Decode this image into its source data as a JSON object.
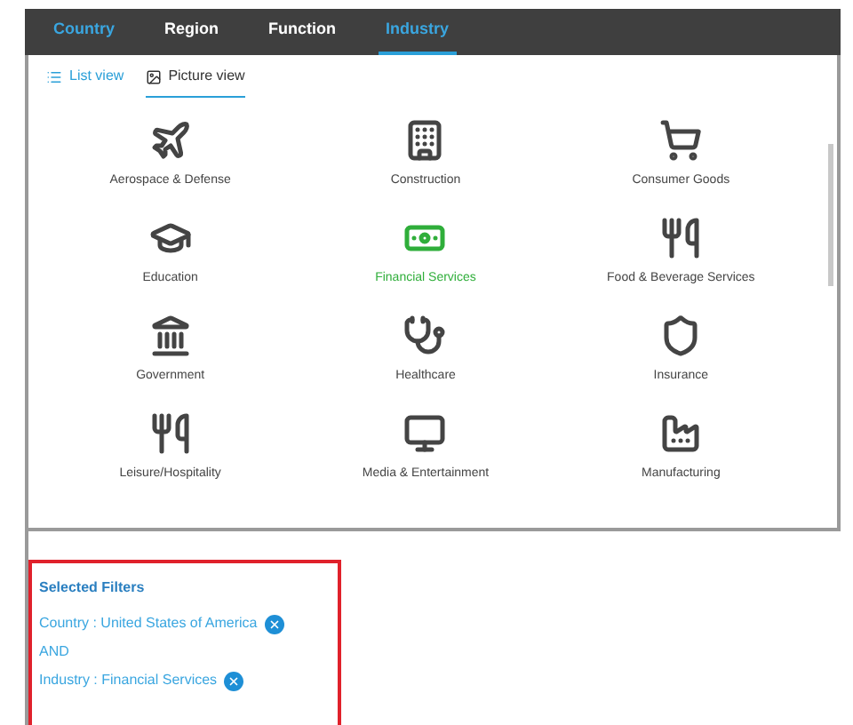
{
  "tabs": [
    {
      "label": "Country",
      "selected": false,
      "filtered": true
    },
    {
      "label": "Region",
      "selected": false,
      "filtered": false
    },
    {
      "label": "Function",
      "selected": false,
      "filtered": false
    },
    {
      "label": "Industry",
      "selected": true,
      "filtered": true
    }
  ],
  "views": [
    {
      "label": "List view",
      "selected": false
    },
    {
      "label": "Picture view",
      "selected": true
    }
  ],
  "industries": [
    {
      "label": "Aerospace & Defense",
      "selected": false
    },
    {
      "label": "Construction",
      "selected": false
    },
    {
      "label": "Consumer Goods",
      "selected": false
    },
    {
      "label": "Education",
      "selected": false
    },
    {
      "label": "Financial Services",
      "selected": true
    },
    {
      "label": "Food & Beverage Services",
      "selected": false
    },
    {
      "label": "Government",
      "selected": false
    },
    {
      "label": "Healthcare",
      "selected": false
    },
    {
      "label": "Insurance",
      "selected": false
    },
    {
      "label": "Leisure/Hospitality",
      "selected": false
    },
    {
      "label": "Media & Entertainment",
      "selected": false
    },
    {
      "label": "Manufacturing",
      "selected": false
    }
  ],
  "selected_filters": {
    "title": "Selected Filters",
    "items": [
      {
        "kind": "filter",
        "text": "Country : United States of America"
      },
      {
        "kind": "operator",
        "text": "AND"
      },
      {
        "kind": "filter",
        "text": "Industry : Financial Services"
      }
    ]
  }
}
